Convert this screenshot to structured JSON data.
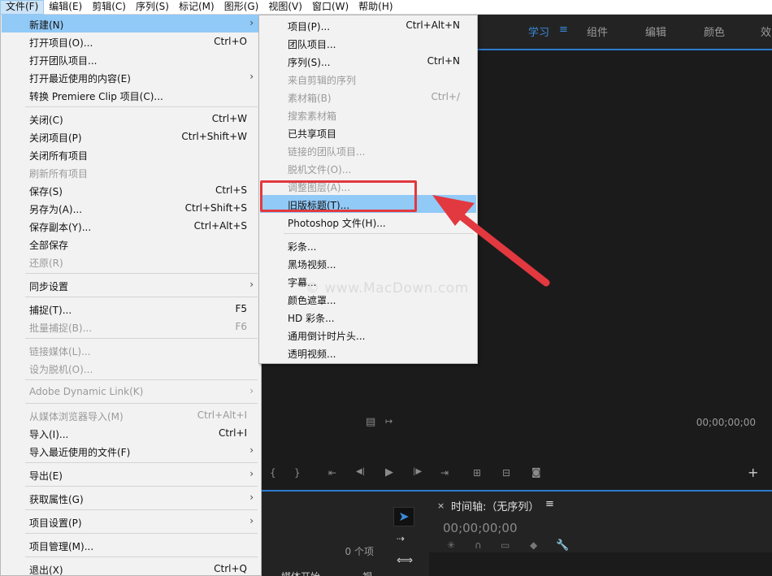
{
  "menubar": {
    "items": [
      {
        "label": "文件(F)",
        "active": true
      },
      {
        "label": "编辑(E)"
      },
      {
        "label": "剪辑(C)"
      },
      {
        "label": "序列(S)"
      },
      {
        "label": "标记(M)"
      },
      {
        "label": "图形(G)"
      },
      {
        "label": "视图(V)"
      },
      {
        "label": "窗口(W)"
      },
      {
        "label": "帮助(H)"
      }
    ]
  },
  "workspaces": {
    "learn": "学习",
    "menu_icon": "≡",
    "assembly": "组件",
    "editing": "编辑",
    "color": "颜色",
    "effects": "效"
  },
  "file_menu": {
    "items": [
      {
        "label": "新建(N)",
        "submenu": true,
        "highlight": true
      },
      {
        "label": "打开项目(O)...",
        "shortcut": "Ctrl+O"
      },
      {
        "label": "打开团队项目..."
      },
      {
        "label": "打开最近使用的内容(E)",
        "submenu": true
      },
      {
        "label": "转换 Premiere Clip 项目(C)..."
      },
      {
        "separator": true
      },
      {
        "label": "关闭(C)",
        "shortcut": "Ctrl+W"
      },
      {
        "label": "关闭项目(P)",
        "shortcut": "Ctrl+Shift+W"
      },
      {
        "label": "关闭所有项目"
      },
      {
        "label": "刷新所有项目",
        "disabled": true
      },
      {
        "label": "保存(S)",
        "shortcut": "Ctrl+S"
      },
      {
        "label": "另存为(A)...",
        "shortcut": "Ctrl+Shift+S"
      },
      {
        "label": "保存副本(Y)...",
        "shortcut": "Ctrl+Alt+S"
      },
      {
        "label": "全部保存"
      },
      {
        "label": "还原(R)",
        "disabled": true
      },
      {
        "separator": true
      },
      {
        "label": "同步设置",
        "submenu": true
      },
      {
        "separator": true
      },
      {
        "label": "捕捉(T)...",
        "shortcut": "F5"
      },
      {
        "label": "批量捕捉(B)...",
        "shortcut": "F6",
        "disabled": true
      },
      {
        "separator": true
      },
      {
        "label": "链接媒体(L)...",
        "disabled": true
      },
      {
        "label": "设为脱机(O)...",
        "disabled": true
      },
      {
        "separator": true
      },
      {
        "label": "Adobe Dynamic Link(K)",
        "submenu": true,
        "disabled": true
      },
      {
        "separator": true
      },
      {
        "label": "从媒体浏览器导入(M)",
        "shortcut": "Ctrl+Alt+I",
        "disabled": true
      },
      {
        "label": "导入(I)...",
        "shortcut": "Ctrl+I"
      },
      {
        "label": "导入最近使用的文件(F)",
        "submenu": true
      },
      {
        "separator": true
      },
      {
        "label": "导出(E)",
        "submenu": true
      },
      {
        "separator": true
      },
      {
        "label": "获取属性(G)",
        "submenu": true
      },
      {
        "separator": true
      },
      {
        "label": "项目设置(P)",
        "submenu": true
      },
      {
        "separator": true
      },
      {
        "label": "项目管理(M)..."
      },
      {
        "separator": true
      },
      {
        "label": "退出(X)",
        "shortcut": "Ctrl+Q"
      }
    ]
  },
  "new_submenu": {
    "items": [
      {
        "label": "项目(P)...",
        "shortcut": "Ctrl+Alt+N"
      },
      {
        "label": "团队项目..."
      },
      {
        "label": "序列(S)...",
        "shortcut": "Ctrl+N"
      },
      {
        "label": "来自剪辑的序列",
        "disabled": true
      },
      {
        "label": "素材箱(B)",
        "shortcut": "Ctrl+/",
        "disabled": true
      },
      {
        "label": "搜索素材箱",
        "disabled": true
      },
      {
        "label": "已共享项目"
      },
      {
        "label": "链接的团队项目...",
        "disabled": true
      },
      {
        "label": "脱机文件(O)...",
        "disabled": true
      },
      {
        "label": "调整图层(A)...",
        "disabled": true
      },
      {
        "label": "旧版标题(T)...",
        "highlight": true
      },
      {
        "label": "Photoshop 文件(H)..."
      },
      {
        "separator": true
      },
      {
        "label": "彩条..."
      },
      {
        "label": "黑场视频..."
      },
      {
        "label": "字幕..."
      },
      {
        "label": "颜色遮罩..."
      },
      {
        "label": "HD 彩条..."
      },
      {
        "label": "通用倒计时片头..."
      },
      {
        "label": "透明视频..."
      }
    ]
  },
  "monitor": {
    "timecode": "00;00;00;00"
  },
  "project_panel": {
    "item_count": "0 个项",
    "column_header": "媒体开始",
    "column_header2": "视"
  },
  "timeline": {
    "title": "时间轴:（无序列）",
    "menu_icon": "≡",
    "timecode": "00;00;00;00"
  },
  "watermark": "© www.MacDown.com",
  "colors": {
    "highlight": "#91c9f7",
    "annotation": "#e2383f",
    "accent": "#2d7bd0"
  }
}
